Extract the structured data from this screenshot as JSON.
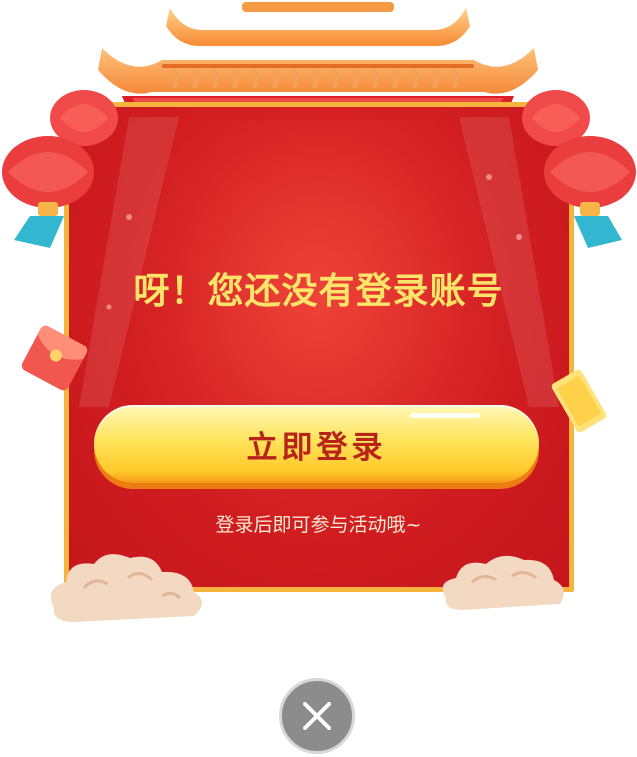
{
  "dialog": {
    "title": "呀！您还没有登录账号",
    "login_label": "立即登录",
    "subtitle": "登录后即可参与活动哦~"
  },
  "icons": {
    "close": "close-icon",
    "roof": "roof-decoration",
    "lantern": "lantern-icon",
    "cloud": "cloud-decoration",
    "red_envelope": "red-envelope-icon",
    "ticket": "ticket-icon"
  },
  "colors": {
    "panel_red": "#d41f22",
    "border_gold": "#f6b43e",
    "title_yellow": "#ffe46a",
    "button_yellow": "#ffe45c",
    "button_text": "#b8231a",
    "close_gray": "#8c8c8c"
  }
}
